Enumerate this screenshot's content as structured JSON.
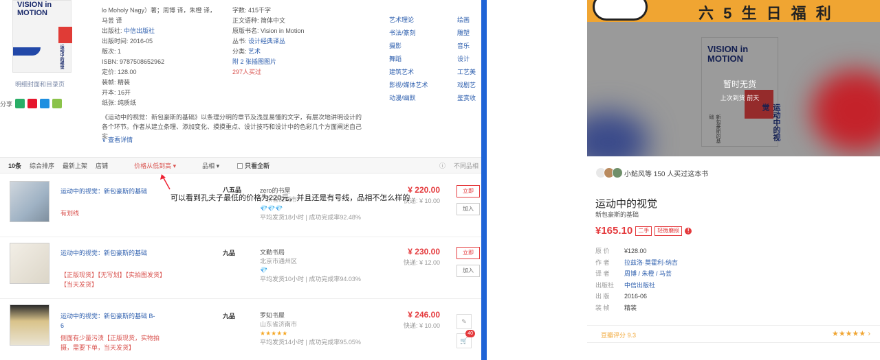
{
  "left": {
    "cover": {
      "title_line1": "VISION in",
      "title_line2": "MOTION",
      "cn": "运动中的视觉"
    },
    "thumb_link": "明细封面和目录页",
    "share_label": "分享",
    "meta_col1": {
      "authors": "lo Moholy Nagy）著；周博 译，朱橙 译，",
      "translator": "马芸 译",
      "publisher_label": "出版社:",
      "publisher": "中信出版社",
      "pubdate": "出版时间: 2016-05",
      "edition": "版次: 1",
      "isbn": "ISBN: 9787508652962",
      "price": "定价: 128.00",
      "binding": "装帧: 精装",
      "format": "开本: 16开",
      "paper": "纸张: 纯质纸"
    },
    "meta_col2": {
      "words": "字数: 415千字",
      "lang": "正文语种: 简体中文",
      "original": "原版书名: Vision in Motion",
      "series_label": "丛书:",
      "series": "设计经典译丛",
      "category_label": "分类:",
      "category": "艺术",
      "attachments": "附 2 张插图图片",
      "buyers": "297人买过"
    },
    "cats_a": [
      "艺术理论",
      "书法/篆刻",
      "摄影",
      "舞蹈",
      "建筑艺术",
      "影视/媒体艺术",
      "动漫/幽默"
    ],
    "cats_b": [
      "绘画",
      "雕塑",
      "音乐",
      "设计",
      "工艺美",
      "戏剧艺",
      "鉴赏收"
    ],
    "desc_line1": "《运动中的视觉：新包豪斯的基础》以条理分明的章节及浅显易懂的文字，有层次地讲明设计的",
    "desc_line2": "各个环节。作者从建立条理、添加变化、摸摸重点、设计技巧和设计中的色彩几个方面阐述自己实",
    "more_label": "查看详情",
    "sortbar": {
      "count": "10条",
      "composite": "综合排序",
      "newest": "最新上架",
      "shop": "店铺",
      "price": "价格从低到高",
      "quality": "品相",
      "instock": "只看全新",
      "right_hint": "不同品相"
    },
    "annotation": "可以看到孔夫子最低的价格为220元，并且还是有号线，品相不怎么样的",
    "items": [
      {
        "title": "运动中的视觉：新包豪斯的基础",
        "tags": "有划线",
        "condition": "八五品",
        "shop": "zero的书屋",
        "location": "广东省深圳市",
        "level": "💎💎💎",
        "rate": "平均发货18小时 | 成功完成率92.48%",
        "price": "¥ 220.00",
        "shipping": "快递: ¥ 10.00",
        "btn1": "立即",
        "btn2": "加入"
      },
      {
        "title": "运动中的视觉：新包豪斯的基础",
        "tags": "【正版现货】【无写划】【实拍图发货】【当天发货】",
        "condition": "九品",
        "shop": "文勤书局",
        "location": "北京市通州区",
        "level": "💎",
        "rate": "平均发货10小时 | 成功完成率94.03%",
        "price": "¥ 230.00",
        "shipping": "快递: ¥ 12.00",
        "btn1": "立即",
        "btn2": "加入"
      },
      {
        "title": "运动中的视觉：新包豪斯的基础 B-6",
        "tags": "侧面有少量污渍【正版现货，实物拍摄，需要下单，当天发货】",
        "condition": "九品",
        "shop": "罗知书屋",
        "location": "山东省济南市",
        "level": "★★★★★",
        "rate": "平均发货14小时 | 成功完成率95.05%",
        "price": "¥ 246.00",
        "shipping": "快递: ¥ 10.00",
        "btn1": "",
        "btn2": ""
      }
    ],
    "cart_count": "40"
  },
  "right": {
    "banner_title": "六 5 生 日 福 利",
    "hero_book_title1": "VISION in",
    "hero_book_title2": "MOTION",
    "hero_book_cn": "运动中的视觉",
    "hero_book_sub": "新包豪斯的基础",
    "no_stock": "暂时无货",
    "last_stock": "上次到货 前天",
    "buyers": "小鲇风等 150 人买过这本书",
    "title": "运动中的视觉",
    "subtitle": "新包豪斯的基础",
    "price": "¥165.10",
    "tag1": "二手",
    "tag2": "轻微磨损",
    "meta": [
      {
        "k": "原 价",
        "v": "¥128.00"
      },
      {
        "k": "作 者",
        "v": "拉兹洛·莫霍利-纳吉"
      },
      {
        "k": "译 者",
        "v": "周博 / 朱橙 / 马芸"
      },
      {
        "k": "出版社",
        "v": "中信出版社"
      },
      {
        "k": "出 版",
        "v": "2016-06"
      },
      {
        "k": "装 帧",
        "v": "精装"
      }
    ],
    "score_label": "豆瓣评分 9.3",
    "score_stars": "★★★★★"
  },
  "colors": {
    "accent_red": "#e4393c",
    "link_blue": "#2e5fae",
    "divider_blue": "#1e63d6",
    "banner_orange": "#f0a532"
  }
}
